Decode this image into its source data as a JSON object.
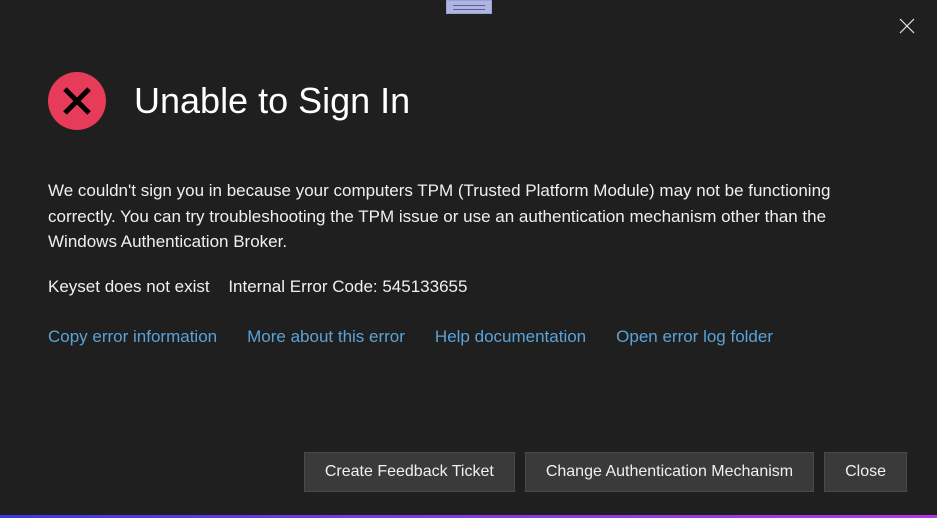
{
  "dialog": {
    "title": "Unable to Sign In",
    "body": "We couldn't sign you in because your computers TPM (Trusted Platform Module) may not be functioning correctly. You can try troubleshooting the TPM issue or use an authentication mechanism other than the Windows Authentication Broker.",
    "error_short": "Keyset does not exist",
    "error_code_label": "Internal Error Code: 545133655"
  },
  "links": {
    "copy": "Copy error information",
    "more": "More about this error",
    "help": "Help documentation",
    "openlog": "Open error log folder"
  },
  "buttons": {
    "feedback": "Create Feedback Ticket",
    "change_auth": "Change Authentication Mechanism",
    "close": "Close"
  }
}
